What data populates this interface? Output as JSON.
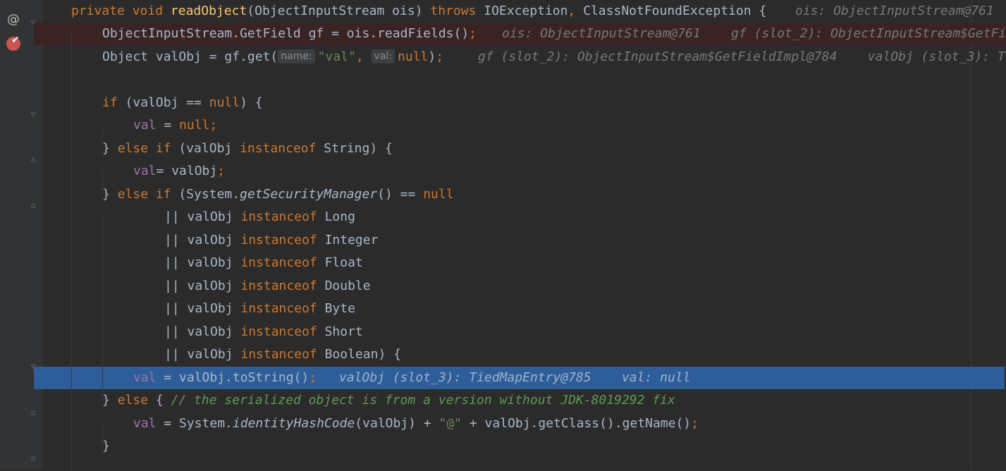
{
  "gutter": {
    "annotation_icon": "@",
    "breakpoint_icon": "breakpoint-checked-icon",
    "fold_icon": "fold-marker-icon"
  },
  "lines": [
    {
      "id": "l1",
      "tokens": [
        {
          "t": "private",
          "c": "kw"
        },
        {
          "t": " ",
          "c": "plain"
        },
        {
          "t": "void",
          "c": "kw"
        },
        {
          "t": " ",
          "c": "plain"
        },
        {
          "t": "readObject",
          "c": "fn"
        },
        {
          "t": "(ObjectInputStream ois) ",
          "c": "plain"
        },
        {
          "t": "throws",
          "c": "kw"
        },
        {
          "t": " IOException",
          "c": "plain"
        },
        {
          "t": ",",
          "c": "kw"
        },
        {
          "t": " ClassNotFoundException {",
          "c": "plain"
        }
      ],
      "inline": "ois: ObjectInputStream@761"
    },
    {
      "id": "l2",
      "tokens": [
        {
          "t": "ObjectInputStream.GetField gf = ois.readFields()",
          "c": "plain"
        },
        {
          "t": ";",
          "c": "kw"
        }
      ],
      "inline": "ois: ObjectInputStream@761    gf (slot_2): ObjectInputStream$GetFi"
    },
    {
      "id": "l3",
      "tokens": [
        {
          "t": "Object valObj = gf.get(",
          "c": "plain"
        },
        {
          "hint": "name:"
        },
        {
          "t": "\"val\"",
          "c": "str"
        },
        {
          "t": ",",
          "c": "kw"
        },
        {
          "t": " ",
          "c": "plain"
        },
        {
          "hint": "val:"
        },
        {
          "t": "null",
          "c": "kw"
        },
        {
          "t": ")",
          "c": "plain"
        },
        {
          "t": ";",
          "c": "kw"
        }
      ],
      "inline": "gf (slot_2): ObjectInputStream$GetFieldImpl@784    valObj (slot_3): T"
    },
    {
      "id": "l4",
      "tokens": [],
      "inline": ""
    },
    {
      "id": "l5",
      "tokens": [
        {
          "t": "if",
          "c": "kw"
        },
        {
          "t": " (valObj == ",
          "c": "plain"
        },
        {
          "t": "null",
          "c": "kw"
        },
        {
          "t": ") {",
          "c": "plain"
        }
      ],
      "inline": ""
    },
    {
      "id": "l6",
      "tokens": [
        {
          "t": "val",
          "c": "fld"
        },
        {
          "t": " = ",
          "c": "plain"
        },
        {
          "t": "null;",
          "c": "kw"
        }
      ],
      "inline": ""
    },
    {
      "id": "l7",
      "tokens": [
        {
          "t": "} ",
          "c": "plain"
        },
        {
          "t": "else if",
          "c": "kw"
        },
        {
          "t": " (valObj ",
          "c": "plain"
        },
        {
          "t": "instanceof",
          "c": "kw"
        },
        {
          "t": " String) {",
          "c": "plain"
        }
      ],
      "inline": ""
    },
    {
      "id": "l8",
      "tokens": [
        {
          "t": "val",
          "c": "fld"
        },
        {
          "t": "= valObj",
          "c": "plain"
        },
        {
          "t": ";",
          "c": "kw"
        }
      ],
      "inline": ""
    },
    {
      "id": "l9",
      "tokens": [
        {
          "t": "} ",
          "c": "plain"
        },
        {
          "t": "else if",
          "c": "kw"
        },
        {
          "t": " (System.",
          "c": "plain"
        },
        {
          "t": "getSecurityManager",
          "c": "ital"
        },
        {
          "t": "() == ",
          "c": "plain"
        },
        {
          "t": "null",
          "c": "kw"
        }
      ],
      "inline": ""
    },
    {
      "id": "l10",
      "tokens": [
        {
          "t": "|| valObj ",
          "c": "plain"
        },
        {
          "t": "instanceof",
          "c": "kw"
        },
        {
          "t": " Long",
          "c": "plain"
        }
      ],
      "inline": ""
    },
    {
      "id": "l11",
      "tokens": [
        {
          "t": "|| valObj ",
          "c": "plain"
        },
        {
          "t": "instanceof",
          "c": "kw"
        },
        {
          "t": " Integer",
          "c": "plain"
        }
      ],
      "inline": ""
    },
    {
      "id": "l12",
      "tokens": [
        {
          "t": "|| valObj ",
          "c": "plain"
        },
        {
          "t": "instanceof",
          "c": "kw"
        },
        {
          "t": " Float",
          "c": "plain"
        }
      ],
      "inline": ""
    },
    {
      "id": "l13",
      "tokens": [
        {
          "t": "|| valObj ",
          "c": "plain"
        },
        {
          "t": "instanceof",
          "c": "kw"
        },
        {
          "t": " Double",
          "c": "plain"
        }
      ],
      "inline": ""
    },
    {
      "id": "l14",
      "tokens": [
        {
          "t": "|| valObj ",
          "c": "plain"
        },
        {
          "t": "instanceof",
          "c": "kw"
        },
        {
          "t": " Byte",
          "c": "plain"
        }
      ],
      "inline": ""
    },
    {
      "id": "l15",
      "tokens": [
        {
          "t": "|| valObj ",
          "c": "plain"
        },
        {
          "t": "instanceof",
          "c": "kw"
        },
        {
          "t": " Short",
          "c": "plain"
        }
      ],
      "inline": ""
    },
    {
      "id": "l16",
      "tokens": [
        {
          "t": "|| valObj ",
          "c": "plain"
        },
        {
          "t": "instanceof",
          "c": "kw"
        },
        {
          "t": " Boolean) {",
          "c": "plain"
        }
      ],
      "inline": ""
    },
    {
      "id": "l17",
      "tokens": [
        {
          "t": "val",
          "c": "fld"
        },
        {
          "t": " = valObj.toString()",
          "c": "plain"
        },
        {
          "t": ";",
          "c": "kw"
        }
      ],
      "inline": "valObj (slot_3): TiedMapEntry@785    val: null"
    },
    {
      "id": "l18",
      "tokens": [
        {
          "t": "} ",
          "c": "plain"
        },
        {
          "t": "else",
          "c": "kw"
        },
        {
          "t": " { ",
          "c": "plain"
        },
        {
          "t": "// the serialized object is from a version without JDK-8019292 fix",
          "c": "cmt"
        }
      ],
      "inline": ""
    },
    {
      "id": "l19",
      "tokens": [
        {
          "t": "val",
          "c": "fld"
        },
        {
          "t": " = System.",
          "c": "plain"
        },
        {
          "t": "identityHashCode",
          "c": "ital"
        },
        {
          "t": "(valObj) + ",
          "c": "plain"
        },
        {
          "t": "\"@\"",
          "c": "str"
        },
        {
          "t": " + valObj.getClass().getName()",
          "c": "plain"
        },
        {
          "t": ";",
          "c": "kw"
        }
      ],
      "inline": ""
    },
    {
      "id": "l20",
      "tokens": [
        {
          "t": "}",
          "c": "plain"
        }
      ],
      "inline": ""
    }
  ],
  "colors": {
    "background": "#2b2b2b",
    "current_line": "#2d5e9a",
    "breakpoint_line": "#3a2323",
    "breakpoint": "#c75450",
    "keyword": "#cc7832",
    "method": "#ffc66d",
    "string": "#6a8759",
    "field": "#9876aa",
    "comment": "#629755"
  }
}
